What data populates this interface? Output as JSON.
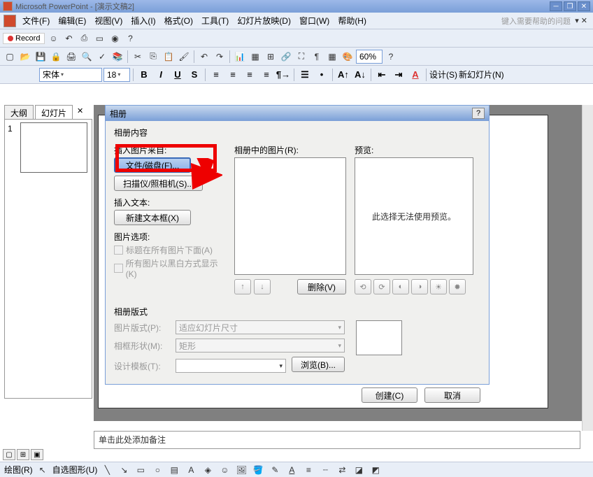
{
  "titlebar": {
    "title": "Microsoft PowerPoint - [演示文稿2]"
  },
  "menubar": {
    "items": [
      {
        "label": "文件(F)"
      },
      {
        "label": "编辑(E)"
      },
      {
        "label": "视图(V)"
      },
      {
        "label": "插入(I)"
      },
      {
        "label": "格式(O)"
      },
      {
        "label": "工具(T)"
      },
      {
        "label": "幻灯片放映(D)"
      },
      {
        "label": "窗口(W)"
      },
      {
        "label": "帮助(H)"
      }
    ],
    "help_placeholder": "键入需要帮助的问题"
  },
  "record": {
    "label": "Record"
  },
  "format": {
    "font": "宋体",
    "size": "18",
    "design": "设计(S)",
    "new_slide": "新幻灯片(N)"
  },
  "zoom": {
    "value": "60%"
  },
  "tabs": {
    "outline": "大纲",
    "slides": "幻灯片"
  },
  "thumb": {
    "num": "1"
  },
  "dialog": {
    "title": "相册",
    "content_label": "相册内容",
    "insert_from": "插入图片来自:",
    "file_disk": "文件/磁盘(F)...",
    "scanner": "扫描仪/照相机(S)...",
    "insert_text": "插入文本:",
    "new_textbox": "新建文本框(X)",
    "pic_options": "图片选项:",
    "caption_below": "标题在所有图片下面(A)",
    "bw_display": "所有图片以黑白方式显示(K)",
    "pics_in_album": "相册中的图片(R):",
    "preview": "预览:",
    "preview_msg": "此选择无法使用预览。",
    "remove": "删除(V)",
    "layout_label": "相册版式",
    "pic_layout": "图片版式(P):",
    "pic_layout_val": "适应幻灯片尺寸",
    "frame_shape": "相框形状(M):",
    "frame_shape_val": "矩形",
    "design_template": "设计模板(T):",
    "browse": "浏览(B)...",
    "create": "创建(C)",
    "cancel": "取消"
  },
  "notes": {
    "placeholder": "单击此处添加备注"
  },
  "status": {
    "draw": "绘图(R)",
    "autoshape": "自选图形(U)"
  }
}
